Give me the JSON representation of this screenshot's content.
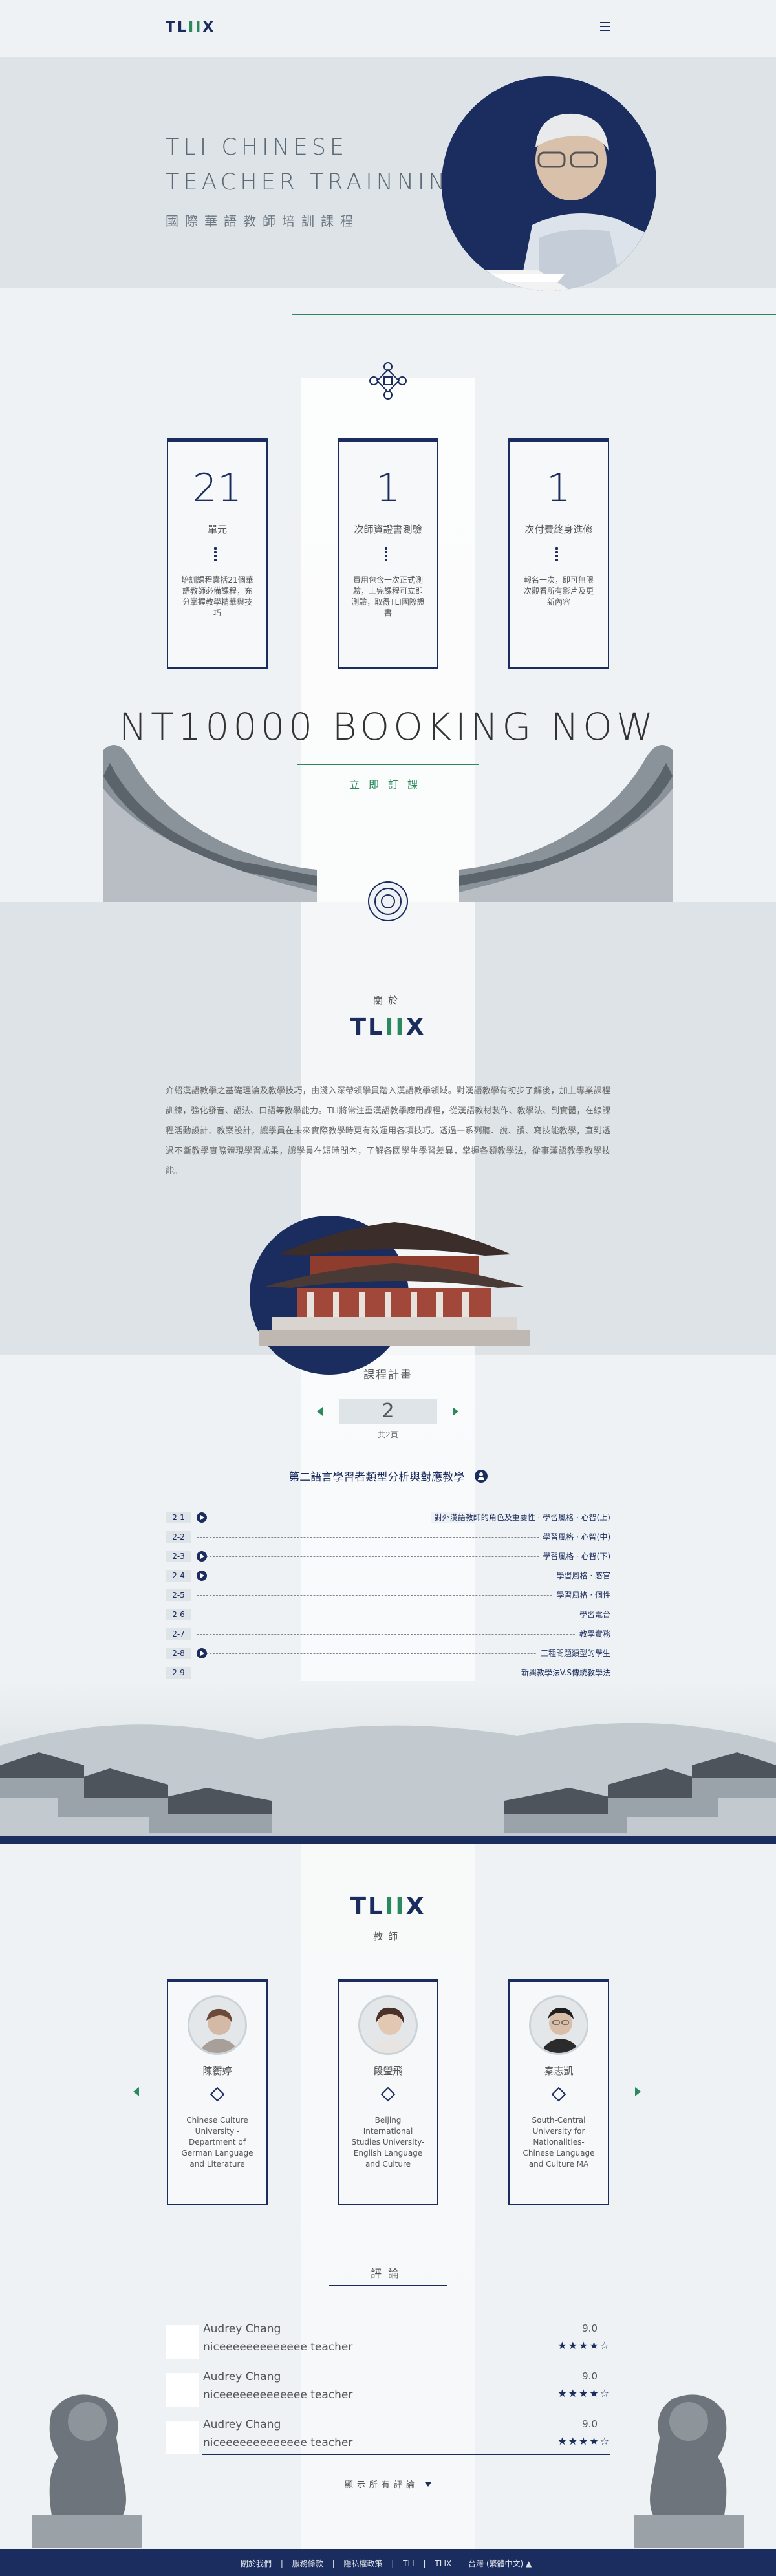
{
  "header": {
    "logo": "TL",
    "logo_plus": "II",
    "logo_end": "X",
    "menu_icon": "hamburger-icon"
  },
  "hero": {
    "title_line1": "TLI CHINESE",
    "title_line2": "TEACHER TRAINNING",
    "subtitle": "國際華語教師培訓課程"
  },
  "stats": [
    {
      "num": "21",
      "unit": "單元",
      "desc": "培訓課程囊括21個華語教師必備課程，充分掌握教學精華與技巧"
    },
    {
      "num": "1",
      "unit": "次師資證書測驗",
      "desc": "費用包含一次正式測驗，上完課程可立即測驗，取得TLI國際證書"
    },
    {
      "num": "1",
      "unit": "次付費終身進修",
      "desc": "報名一次，即可無限次觀看所有影片及更新內容"
    }
  ],
  "offer": {
    "price": "NT10000 BOOKING NOW",
    "book": "立即訂課"
  },
  "about": {
    "label": "關於",
    "logo": "TL",
    "logo_plus": "II",
    "logo_end": "X",
    "text": "介紹漢語教學之基礎理論及教學技巧，由淺入深帶領學員踏入漢語教學領域。對漢語教學有初步了解後，加上專業課程訓練，強化發音、語法、口語等教學能力。TLI將常注重漢語教學應用課程，從漢語教材製作、教學法、到實體，在線課程活動設計、教案設計，讓學員在未來實際教學時更有效運用各項技巧。透過一系列聽、說、讀、寫技能教學，直到透過不斷教學實際體現學習成果，讓學員在短時間內，了解各國學生學習差異，掌握各類教學法，從事漢語教學教學技能。"
  },
  "plan": {
    "title": "課程計畫",
    "page": "2",
    "page_info": "共2頁",
    "topic": "第二語言學習者類型分析與對應教學"
  },
  "lessons": [
    {
      "code": "2-1",
      "title": "對外漢語教師的角色及重要性 · 學習風格 · 心智(上)",
      "video": true
    },
    {
      "code": "2-2",
      "title": "學習風格 · 心智(中)",
      "video": false
    },
    {
      "code": "2-3",
      "title": "學習風格 · 心智(下)",
      "video": true
    },
    {
      "code": "2-4",
      "title": "學習風格 · 感官",
      "video": true
    },
    {
      "code": "2-5",
      "title": "學習風格 · 個性",
      "video": false
    },
    {
      "code": "2-6",
      "title": "學習電台",
      "video": false
    },
    {
      "code": "2-7",
      "title": "教學實務",
      "video": false
    },
    {
      "code": "2-8",
      "title": "三種問題類型的學生",
      "video": true
    },
    {
      "code": "2-9",
      "title": "新興教學法V.S傳統教學法",
      "video": false
    }
  ],
  "teachers_section": {
    "logo": "TL",
    "logo_plus": "II",
    "logo_end": "X",
    "label": "教師"
  },
  "teachers": [
    {
      "name": "陳蘅婷",
      "desc": "Chinese Culture University - Department of German Language and Literature"
    },
    {
      "name": "段瑩飛",
      "desc": "Beijing International Studies University-English Language and Culture"
    },
    {
      "name": "秦志凱",
      "desc": "South-Central University for Nationalities-Chinese Language and Culture MA"
    }
  ],
  "reviews_section": {
    "title": "評論",
    "show_all": "顯示所有評論"
  },
  "reviews": [
    {
      "name": "Audrey Chang",
      "msg": "niceeeeeeeeeeeee   teacher",
      "score": "9.0",
      "stars": "★★★★☆"
    },
    {
      "name": "Audrey Chang",
      "msg": "niceeeeeeeeeeeee   teacher",
      "score": "9.0",
      "stars": "★★★★☆"
    },
    {
      "name": "Audrey Chang",
      "msg": "niceeeeeeeeeeeee   teacher",
      "score": "9.0",
      "stars": "★★★★☆"
    }
  ],
  "footer": {
    "links": [
      "關於我們",
      "服務條款",
      "隱私權政策",
      "TLI",
      "TLIX"
    ],
    "lang": "台灣 (繁體中文) ▲"
  },
  "colors": {
    "navy": "#1b2c5e",
    "green": "#2a8a5e",
    "bg": "#eef2f4"
  }
}
